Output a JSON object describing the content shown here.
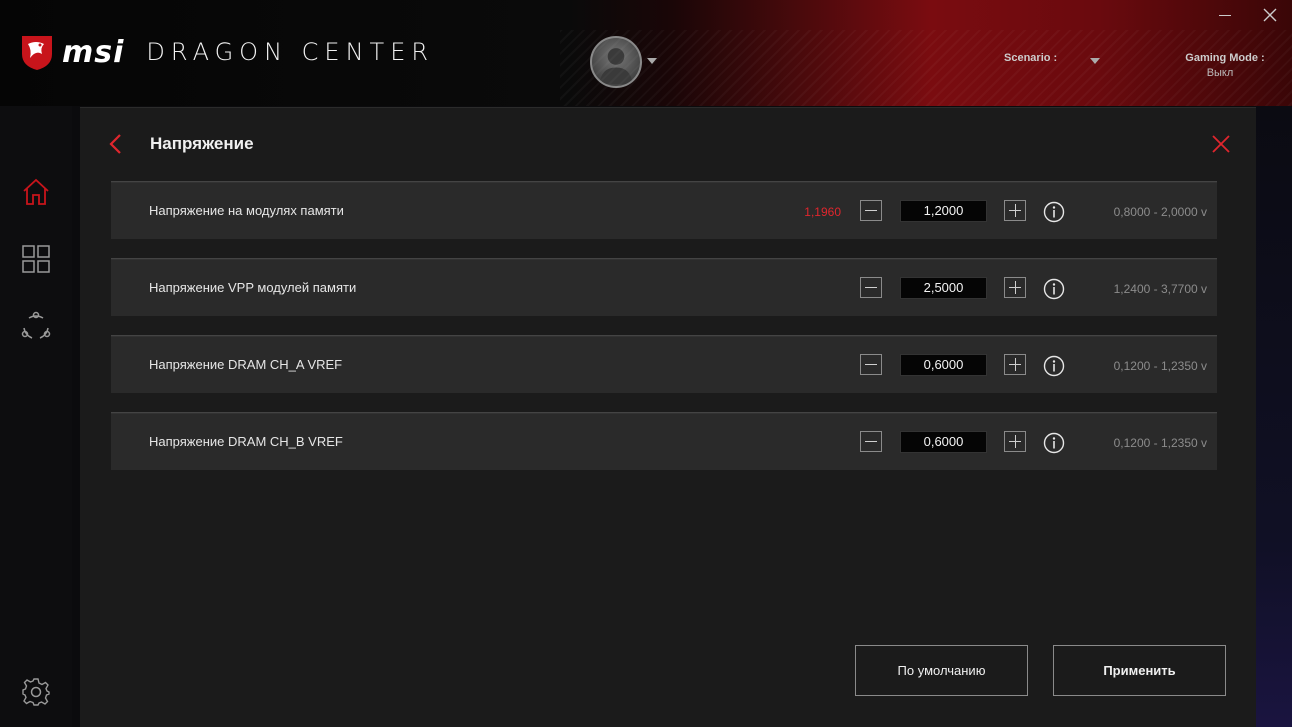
{
  "header": {
    "brand": "msi",
    "app_name": "DRAGON CENTER",
    "scenario_label": "Scenario :",
    "gaming_mode_label": "Gaming Mode :",
    "gaming_mode_value": "Выкл"
  },
  "panel": {
    "title": "Напряжение"
  },
  "rows": [
    {
      "label": "Напряжение на модулях памяти",
      "current": "1,1960",
      "value": "1,2000",
      "range": "0,8000 - 2,0000 v"
    },
    {
      "label": "Напряжение VPP модулей памяти",
      "current": "",
      "value": "2,5000",
      "range": "1,2400 - 3,7700 v"
    },
    {
      "label": "Напряжение DRAM CH_A VREF",
      "current": "",
      "value": "0,6000",
      "range": "0,1200 - 1,2350 v"
    },
    {
      "label": "Напряжение DRAM CH_B VREF",
      "current": "",
      "value": "0,6000",
      "range": "0,1200 - 1,2350 v"
    }
  ],
  "buttons": {
    "default_label": "По умолчанию",
    "apply_label": "Применить"
  },
  "colors": {
    "accent": "#e0262d",
    "panel_bg": "#1b1b1b",
    "row_bg": "#2a2a2a"
  },
  "icons": {
    "sidebar": [
      "home-icon",
      "grid-icon",
      "share-icon",
      "gear-icon"
    ]
  }
}
